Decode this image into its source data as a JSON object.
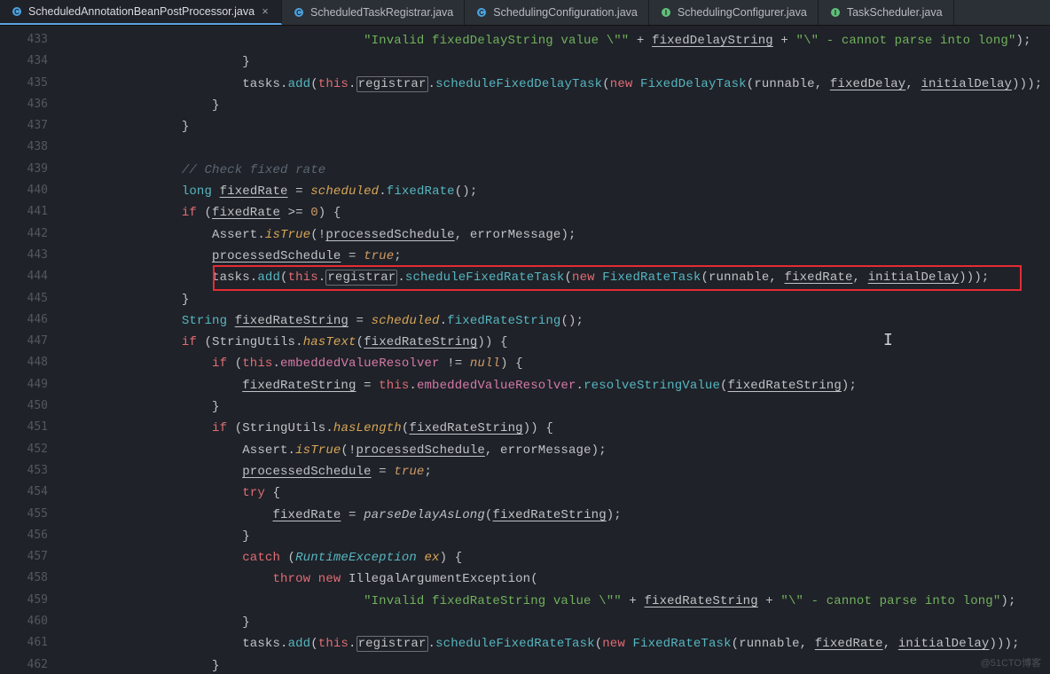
{
  "tabs": [
    {
      "name": "ScheduledAnnotationBeanPostProcessor.java",
      "icon": "class",
      "active": true
    },
    {
      "name": "ScheduledTaskRegistrar.java",
      "icon": "class",
      "active": false
    },
    {
      "name": "SchedulingConfiguration.java",
      "icon": "class",
      "active": false
    },
    {
      "name": "SchedulingConfigurer.java",
      "icon": "interface",
      "active": false
    },
    {
      "name": "TaskScheduler.java",
      "icon": "interface",
      "active": false
    }
  ],
  "gutter": {
    "start": 433,
    "end": 462
  },
  "highlight_box_line": 444,
  "watermark": "@51CTO博客",
  "selected_identifier": "registrar",
  "code_lines": [
    {
      "n": 433,
      "indent": 40,
      "tokens": [
        {
          "t": "\"Invalid fixedDelayString value \\\"\"",
          "c": "tok-str"
        },
        {
          "t": " + ",
          "c": "tok-op"
        },
        {
          "t": "fixedDelayString",
          "c": "tok-ident tok-under"
        },
        {
          "t": " + ",
          "c": "tok-op"
        },
        {
          "t": "\"\\\" - cannot parse into long\"",
          "c": "tok-str"
        },
        {
          "t": ");",
          "c": "tok-punct"
        }
      ]
    },
    {
      "n": 434,
      "indent": 24,
      "tokens": [
        {
          "t": "}",
          "c": "tok-punct"
        }
      ]
    },
    {
      "n": 435,
      "indent": 24,
      "tokens": [
        {
          "t": "tasks",
          "c": "tok-ident"
        },
        {
          "t": ".",
          "c": "tok-punct"
        },
        {
          "t": "add",
          "c": "tok-method"
        },
        {
          "t": "(",
          "c": "tok-punct"
        },
        {
          "t": "this",
          "c": "tok-kw"
        },
        {
          "t": ".",
          "c": "tok-punct"
        },
        {
          "t": "registrar",
          "c": "tok-ident sel"
        },
        {
          "t": ".",
          "c": "tok-punct"
        },
        {
          "t": "scheduleFixedDelayTask",
          "c": "tok-method"
        },
        {
          "t": "(",
          "c": "tok-punct"
        },
        {
          "t": "new",
          "c": "tok-kw"
        },
        {
          "t": " ",
          "c": "tok-punct"
        },
        {
          "t": "FixedDelayTask",
          "c": "tok-method"
        },
        {
          "t": "(",
          "c": "tok-punct"
        },
        {
          "t": "runnable",
          "c": "tok-ident"
        },
        {
          "t": ", ",
          "c": "tok-punct"
        },
        {
          "t": "fixedDelay",
          "c": "tok-ident tok-under"
        },
        {
          "t": ", ",
          "c": "tok-punct"
        },
        {
          "t": "initialDelay",
          "c": "tok-ident tok-under"
        },
        {
          "t": ")));",
          "c": "tok-punct"
        }
      ]
    },
    {
      "n": 436,
      "indent": 20,
      "tokens": [
        {
          "t": "}",
          "c": "tok-punct"
        }
      ]
    },
    {
      "n": 437,
      "indent": 16,
      "tokens": [
        {
          "t": "}",
          "c": "tok-punct"
        }
      ]
    },
    {
      "n": 438,
      "indent": 0,
      "tokens": []
    },
    {
      "n": 439,
      "indent": 16,
      "tokens": [
        {
          "t": "// Check fixed rate",
          "c": "tok-comment"
        }
      ]
    },
    {
      "n": 440,
      "indent": 16,
      "tokens": [
        {
          "t": "long",
          "c": "tok-type"
        },
        {
          "t": " ",
          "c": "tok-punct"
        },
        {
          "t": "fixedRate",
          "c": "tok-ident tok-under"
        },
        {
          "t": " = ",
          "c": "tok-op"
        },
        {
          "t": "scheduled",
          "c": "tok-goldital"
        },
        {
          "t": ".",
          "c": "tok-punct"
        },
        {
          "t": "fixedRate",
          "c": "tok-method"
        },
        {
          "t": "();",
          "c": "tok-punct"
        }
      ]
    },
    {
      "n": 441,
      "indent": 16,
      "tokens": [
        {
          "t": "if",
          "c": "tok-kw"
        },
        {
          "t": " (",
          "c": "tok-punct"
        },
        {
          "t": "fixedRate",
          "c": "tok-ident tok-under"
        },
        {
          "t": " >= ",
          "c": "tok-op"
        },
        {
          "t": "0",
          "c": "tok-num"
        },
        {
          "t": ") {",
          "c": "tok-punct"
        }
      ]
    },
    {
      "n": 442,
      "indent": 20,
      "tokens": [
        {
          "t": "Assert",
          "c": "tok-class"
        },
        {
          "t": ".",
          "c": "tok-punct"
        },
        {
          "t": "isTrue",
          "c": "tok-goldital"
        },
        {
          "t": "(!",
          "c": "tok-punct"
        },
        {
          "t": "processedSchedule",
          "c": "tok-ident tok-under"
        },
        {
          "t": ", ",
          "c": "tok-punct"
        },
        {
          "t": "errorMessage",
          "c": "tok-ident"
        },
        {
          "t": ");",
          "c": "tok-punct"
        }
      ]
    },
    {
      "n": 443,
      "indent": 20,
      "tokens": [
        {
          "t": "processedSchedule",
          "c": "tok-ident tok-under"
        },
        {
          "t": " = ",
          "c": "tok-op"
        },
        {
          "t": "true",
          "c": "tok-const"
        },
        {
          "t": ";",
          "c": "tok-punct"
        }
      ]
    },
    {
      "n": 444,
      "indent": 20,
      "tokens": [
        {
          "t": "tasks",
          "c": "tok-ident"
        },
        {
          "t": ".",
          "c": "tok-punct"
        },
        {
          "t": "add",
          "c": "tok-method"
        },
        {
          "t": "(",
          "c": "tok-punct"
        },
        {
          "t": "this",
          "c": "tok-kw"
        },
        {
          "t": ".",
          "c": "tok-punct"
        },
        {
          "t": "registrar",
          "c": "tok-ident sel"
        },
        {
          "t": ".",
          "c": "tok-punct"
        },
        {
          "t": "scheduleFixedRateTask",
          "c": "tok-method"
        },
        {
          "t": "(",
          "c": "tok-punct"
        },
        {
          "t": "new",
          "c": "tok-kw"
        },
        {
          "t": " ",
          "c": "tok-punct"
        },
        {
          "t": "FixedRateTask",
          "c": "tok-method"
        },
        {
          "t": "(",
          "c": "tok-punct"
        },
        {
          "t": "runnable",
          "c": "tok-ident"
        },
        {
          "t": ", ",
          "c": "tok-punct"
        },
        {
          "t": "fixedRate",
          "c": "tok-ident tok-under"
        },
        {
          "t": ", ",
          "c": "tok-punct"
        },
        {
          "t": "initialDelay",
          "c": "tok-ident tok-under"
        },
        {
          "t": ")));",
          "c": "tok-punct"
        }
      ]
    },
    {
      "n": 445,
      "indent": 16,
      "tokens": [
        {
          "t": "}",
          "c": "tok-punct"
        }
      ]
    },
    {
      "n": 446,
      "indent": 16,
      "tokens": [
        {
          "t": "String",
          "c": "tok-type"
        },
        {
          "t": " ",
          "c": "tok-punct"
        },
        {
          "t": "fixedRateString",
          "c": "tok-ident tok-under"
        },
        {
          "t": " = ",
          "c": "tok-op"
        },
        {
          "t": "scheduled",
          "c": "tok-goldital"
        },
        {
          "t": ".",
          "c": "tok-punct"
        },
        {
          "t": "fixedRateString",
          "c": "tok-method"
        },
        {
          "t": "();",
          "c": "tok-punct"
        }
      ]
    },
    {
      "n": 447,
      "indent": 16,
      "tokens": [
        {
          "t": "if",
          "c": "tok-kw"
        },
        {
          "t": " (",
          "c": "tok-punct"
        },
        {
          "t": "StringUtils",
          "c": "tok-class"
        },
        {
          "t": ".",
          "c": "tok-punct"
        },
        {
          "t": "hasText",
          "c": "tok-goldital"
        },
        {
          "t": "(",
          "c": "tok-punct"
        },
        {
          "t": "fixedRateString",
          "c": "tok-ident tok-under"
        },
        {
          "t": ")) {",
          "c": "tok-punct"
        }
      ]
    },
    {
      "n": 448,
      "indent": 20,
      "tokens": [
        {
          "t": "if",
          "c": "tok-kw"
        },
        {
          "t": " (",
          "c": "tok-punct"
        },
        {
          "t": "this",
          "c": "tok-kw"
        },
        {
          "t": ".",
          "c": "tok-punct"
        },
        {
          "t": "embeddedValueResolver",
          "c": "tok-field"
        },
        {
          "t": " != ",
          "c": "tok-op"
        },
        {
          "t": "null",
          "c": "tok-const"
        },
        {
          "t": ") {",
          "c": "tok-punct"
        }
      ]
    },
    {
      "n": 449,
      "indent": 24,
      "tokens": [
        {
          "t": "fixedRateString",
          "c": "tok-ident tok-under"
        },
        {
          "t": " = ",
          "c": "tok-op"
        },
        {
          "t": "this",
          "c": "tok-kw"
        },
        {
          "t": ".",
          "c": "tok-punct"
        },
        {
          "t": "embeddedValueResolver",
          "c": "tok-field"
        },
        {
          "t": ".",
          "c": "tok-punct"
        },
        {
          "t": "resolveStringValue",
          "c": "tok-method"
        },
        {
          "t": "(",
          "c": "tok-punct"
        },
        {
          "t": "fixedRateString",
          "c": "tok-ident tok-under"
        },
        {
          "t": ");",
          "c": "tok-punct"
        }
      ]
    },
    {
      "n": 450,
      "indent": 20,
      "tokens": [
        {
          "t": "}",
          "c": "tok-punct"
        }
      ]
    },
    {
      "n": 451,
      "indent": 20,
      "tokens": [
        {
          "t": "if",
          "c": "tok-kw"
        },
        {
          "t": " (",
          "c": "tok-punct"
        },
        {
          "t": "StringUtils",
          "c": "tok-class"
        },
        {
          "t": ".",
          "c": "tok-punct"
        },
        {
          "t": "hasLength",
          "c": "tok-goldital"
        },
        {
          "t": "(",
          "c": "tok-punct"
        },
        {
          "t": "fixedRateString",
          "c": "tok-ident tok-under"
        },
        {
          "t": ")) {",
          "c": "tok-punct"
        }
      ]
    },
    {
      "n": 452,
      "indent": 24,
      "tokens": [
        {
          "t": "Assert",
          "c": "tok-class"
        },
        {
          "t": ".",
          "c": "tok-punct"
        },
        {
          "t": "isTrue",
          "c": "tok-goldital"
        },
        {
          "t": "(!",
          "c": "tok-punct"
        },
        {
          "t": "processedSchedule",
          "c": "tok-ident tok-under"
        },
        {
          "t": ", ",
          "c": "tok-punct"
        },
        {
          "t": "errorMessage",
          "c": "tok-ident"
        },
        {
          "t": ");",
          "c": "tok-punct"
        }
      ]
    },
    {
      "n": 453,
      "indent": 24,
      "tokens": [
        {
          "t": "processedSchedule",
          "c": "tok-ident tok-under"
        },
        {
          "t": " = ",
          "c": "tok-op"
        },
        {
          "t": "true",
          "c": "tok-const"
        },
        {
          "t": ";",
          "c": "tok-punct"
        }
      ]
    },
    {
      "n": 454,
      "indent": 24,
      "tokens": [
        {
          "t": "try",
          "c": "tok-kw"
        },
        {
          "t": " {",
          "c": "tok-punct"
        }
      ]
    },
    {
      "n": 455,
      "indent": 28,
      "tokens": [
        {
          "t": "fixedRate",
          "c": "tok-ident tok-under"
        },
        {
          "t": " = ",
          "c": "tok-op"
        },
        {
          "t": "parseDelayAsLong",
          "c": "tok-normital"
        },
        {
          "t": "(",
          "c": "tok-punct"
        },
        {
          "t": "fixedRateString",
          "c": "tok-ident tok-under"
        },
        {
          "t": ");",
          "c": "tok-punct"
        }
      ]
    },
    {
      "n": 456,
      "indent": 24,
      "tokens": [
        {
          "t": "}",
          "c": "tok-punct"
        }
      ]
    },
    {
      "n": 457,
      "indent": 24,
      "tokens": [
        {
          "t": "catch",
          "c": "tok-kw"
        },
        {
          "t": " (",
          "c": "tok-punct"
        },
        {
          "t": "RuntimeException",
          "c": "tok-type",
          "ital": true
        },
        {
          "t": " ",
          "c": "tok-punct"
        },
        {
          "t": "ex",
          "c": "tok-goldital"
        },
        {
          "t": ") {",
          "c": "tok-punct"
        }
      ]
    },
    {
      "n": 458,
      "indent": 28,
      "tokens": [
        {
          "t": "throw",
          "c": "tok-kw"
        },
        {
          "t": " ",
          "c": "tok-punct"
        },
        {
          "t": "new",
          "c": "tok-kw"
        },
        {
          "t": " ",
          "c": "tok-punct"
        },
        {
          "t": "IllegalArgumentException",
          "c": "tok-ident"
        },
        {
          "t": "(",
          "c": "tok-punct"
        }
      ]
    },
    {
      "n": 459,
      "indent": 40,
      "tokens": [
        {
          "t": "\"Invalid fixedRateString value \\\"\"",
          "c": "tok-str"
        },
        {
          "t": " + ",
          "c": "tok-op"
        },
        {
          "t": "fixedRateString",
          "c": "tok-ident tok-under"
        },
        {
          "t": " + ",
          "c": "tok-op"
        },
        {
          "t": "\"\\\" - cannot parse into long\"",
          "c": "tok-str"
        },
        {
          "t": ");",
          "c": "tok-punct"
        }
      ]
    },
    {
      "n": 460,
      "indent": 24,
      "tokens": [
        {
          "t": "}",
          "c": "tok-punct"
        }
      ]
    },
    {
      "n": 461,
      "indent": 24,
      "tokens": [
        {
          "t": "tasks",
          "c": "tok-ident"
        },
        {
          "t": ".",
          "c": "tok-punct"
        },
        {
          "t": "add",
          "c": "tok-method"
        },
        {
          "t": "(",
          "c": "tok-punct"
        },
        {
          "t": "this",
          "c": "tok-kw"
        },
        {
          "t": ".",
          "c": "tok-punct"
        },
        {
          "t": "registrar",
          "c": "tok-ident sel"
        },
        {
          "t": ".",
          "c": "tok-punct"
        },
        {
          "t": "scheduleFixedRateTask",
          "c": "tok-method"
        },
        {
          "t": "(",
          "c": "tok-punct"
        },
        {
          "t": "new",
          "c": "tok-kw"
        },
        {
          "t": " ",
          "c": "tok-punct"
        },
        {
          "t": "FixedRateTask",
          "c": "tok-method"
        },
        {
          "t": "(",
          "c": "tok-punct"
        },
        {
          "t": "runnable",
          "c": "tok-ident"
        },
        {
          "t": ", ",
          "c": "tok-punct"
        },
        {
          "t": "fixedRate",
          "c": "tok-ident tok-under"
        },
        {
          "t": ", ",
          "c": "tok-punct"
        },
        {
          "t": "initialDelay",
          "c": "tok-ident tok-under"
        },
        {
          "t": ")));",
          "c": "tok-punct"
        }
      ]
    },
    {
      "n": 462,
      "indent": 20,
      "tokens": [
        {
          "t": "}",
          "c": "tok-punct"
        }
      ]
    }
  ]
}
